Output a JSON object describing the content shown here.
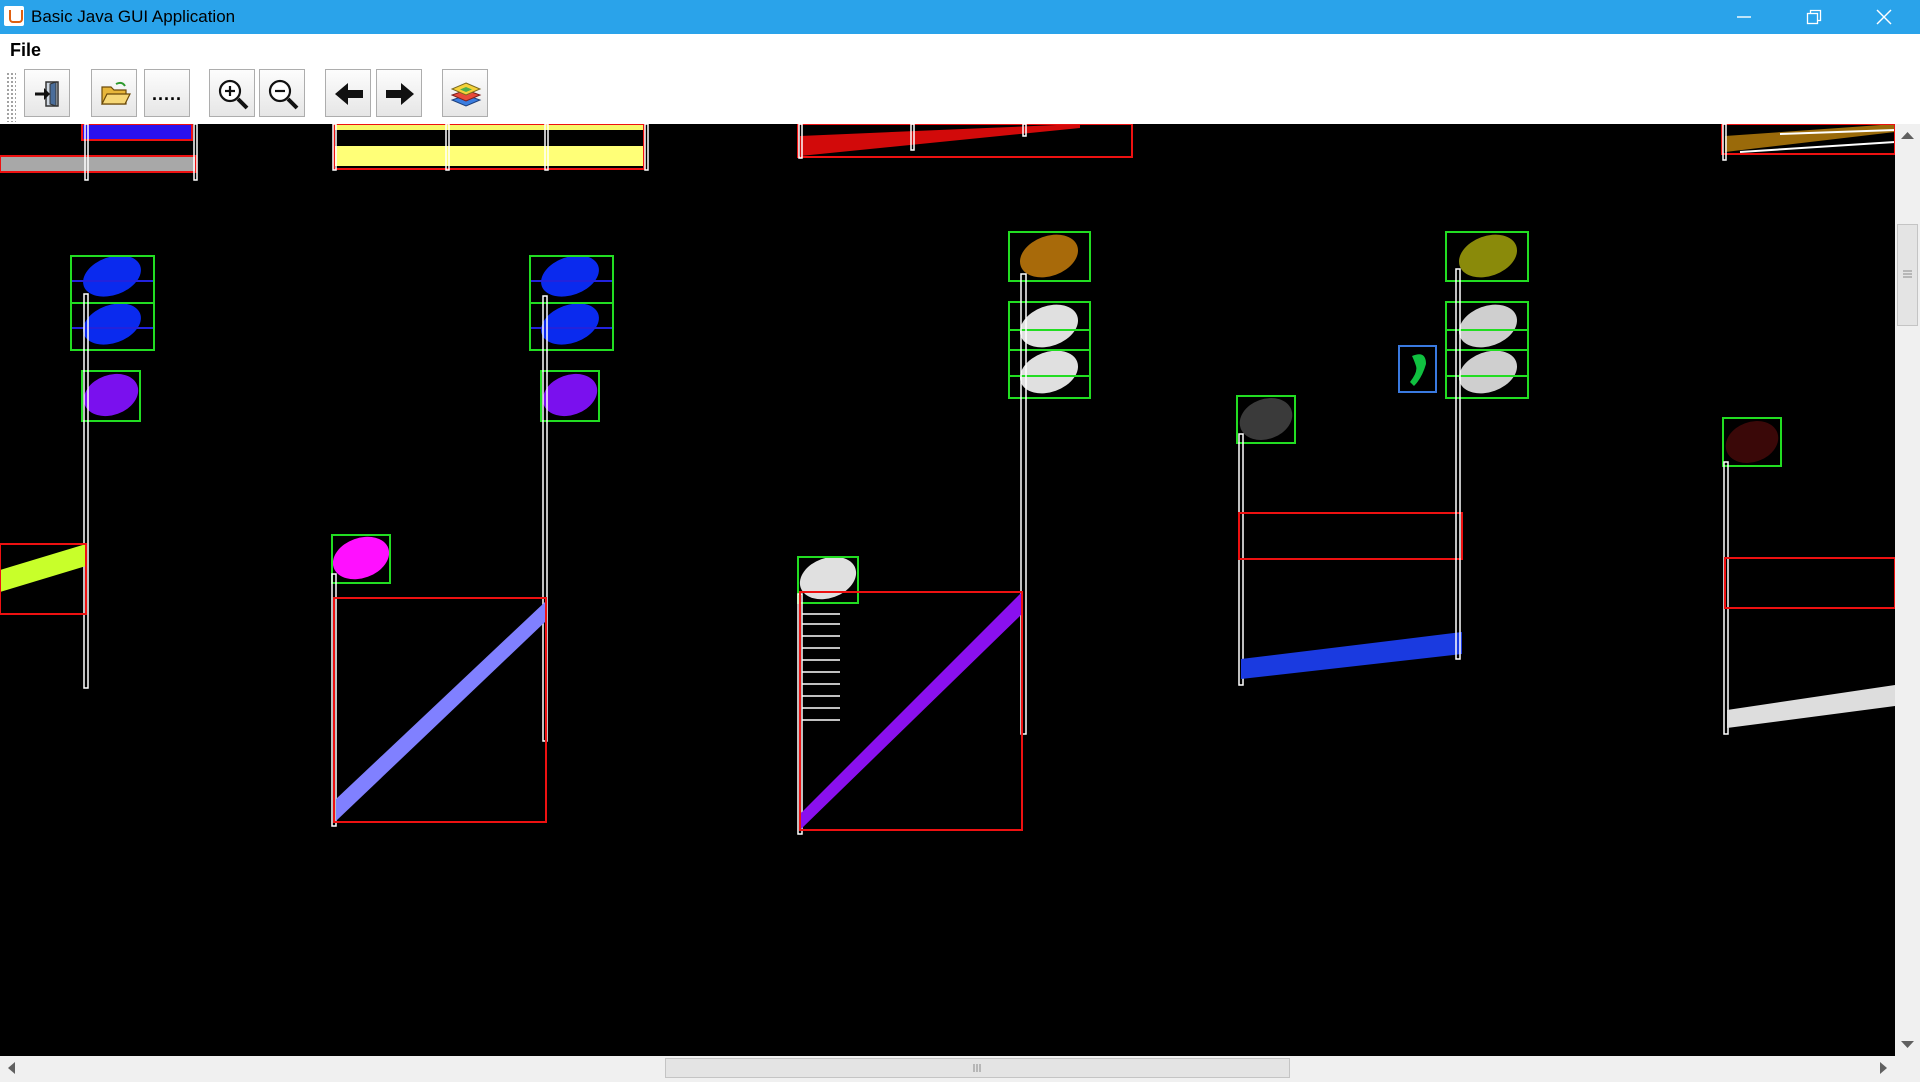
{
  "window": {
    "title": "Basic Java GUI Application"
  },
  "menu": {
    "file_label": "File"
  },
  "toolbar": {
    "more_label": "....."
  },
  "canvas": {
    "background": "#000000",
    "box_colors": {
      "note_box": "#22dd22",
      "staff_box": "#ee1111",
      "stem": "#ffffff"
    }
  }
}
